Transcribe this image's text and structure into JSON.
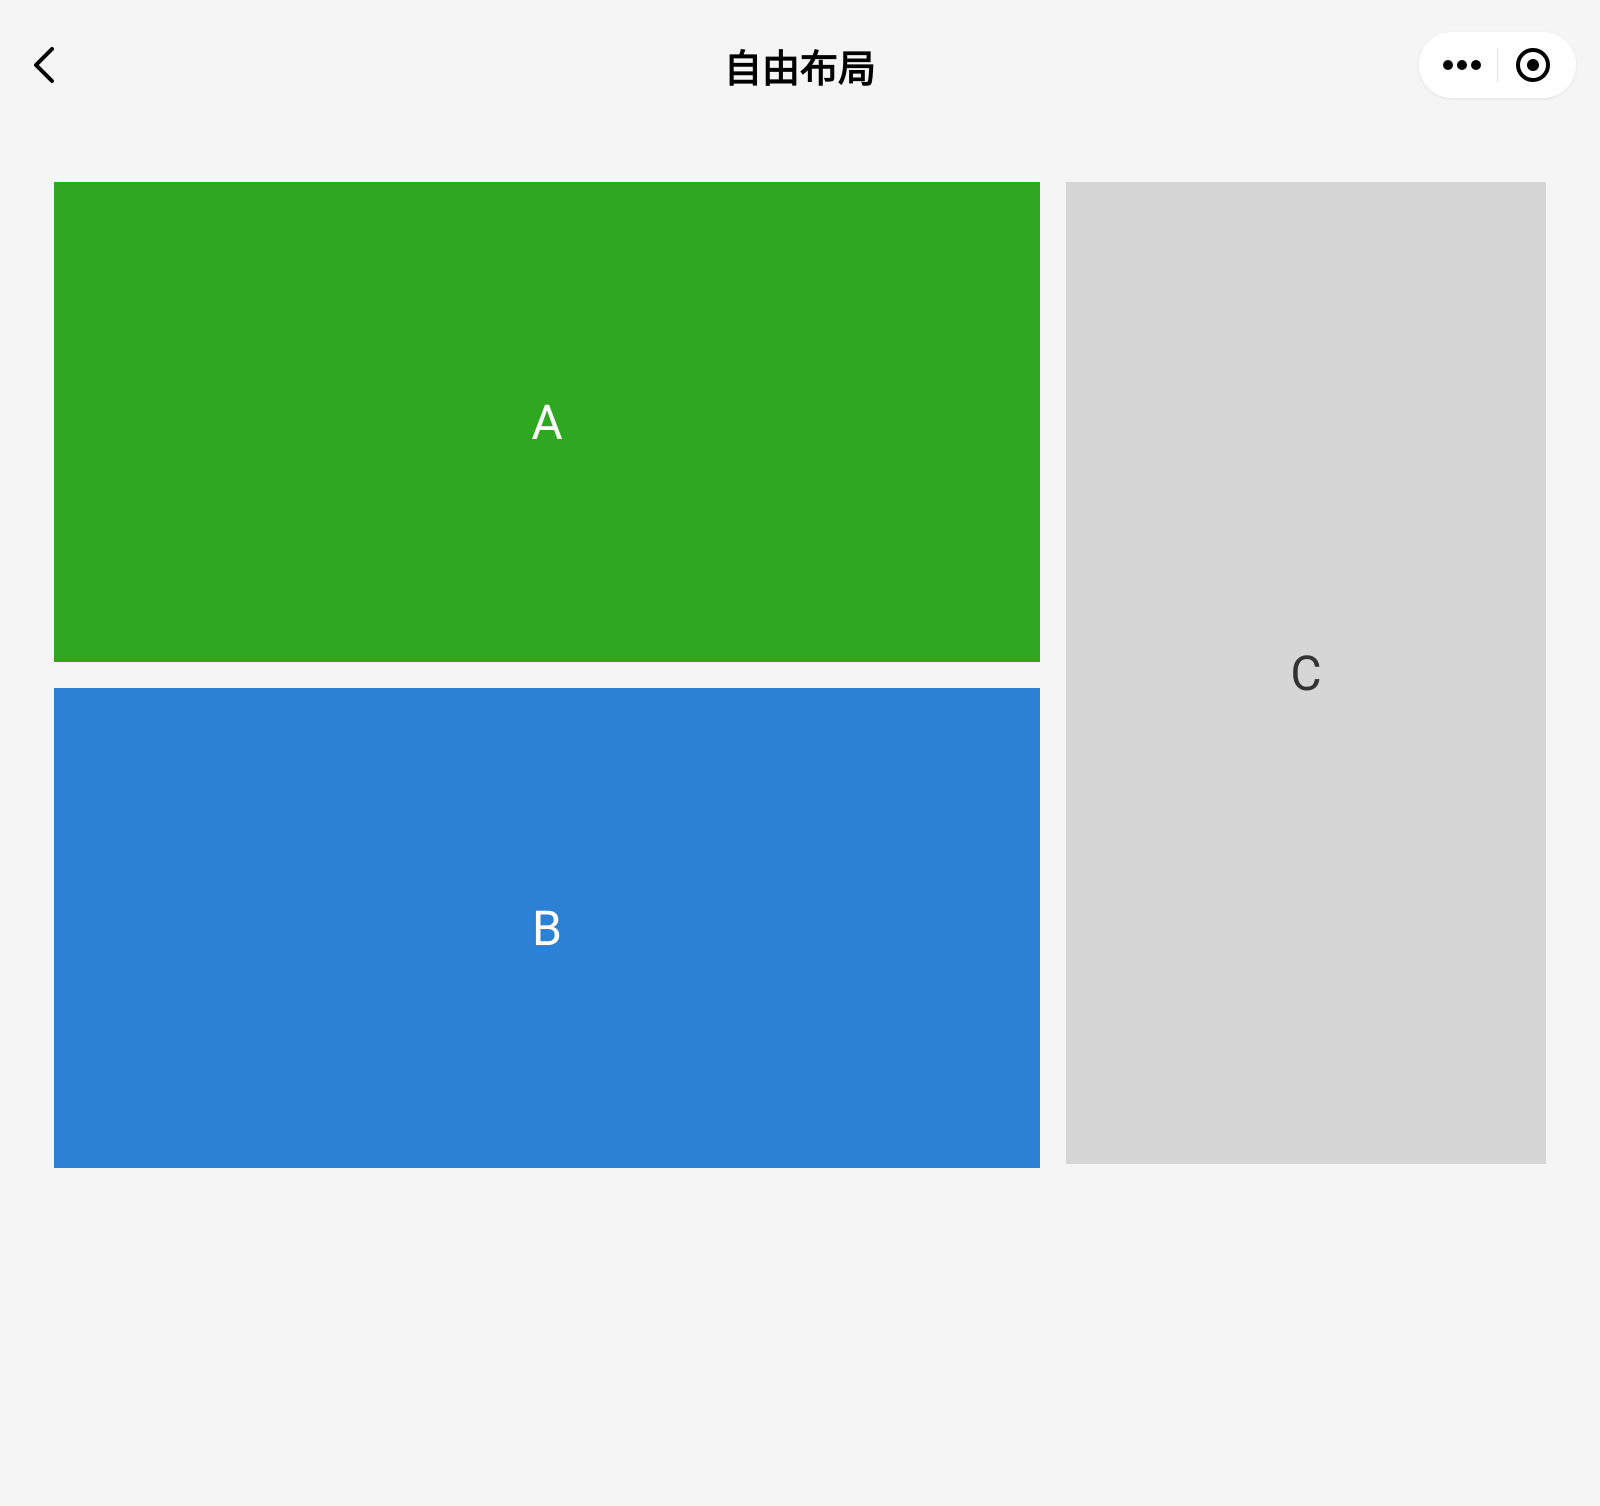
{
  "header": {
    "title": "自由布局"
  },
  "boxes": {
    "a": {
      "label": "A"
    },
    "b": {
      "label": "B"
    },
    "c": {
      "label": "C"
    }
  }
}
